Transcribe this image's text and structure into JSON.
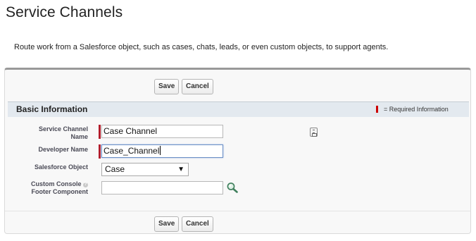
{
  "page": {
    "title": "Service Channels",
    "description": "Route work from a Salesforce object, such as cases, chats, leads, or even custom objects, to support agents."
  },
  "toolbar": {
    "save_label": "Save",
    "cancel_label": "Cancel"
  },
  "section": {
    "title": "Basic Information",
    "required_legend": "= Required Information"
  },
  "fields": {
    "channel_name": {
      "label_line1": "Service Channel",
      "label_line2": "Name",
      "value": "Case Channel",
      "icon": "context-menu-icon"
    },
    "developer_name": {
      "label": "Developer Name",
      "value": "Case_Channel"
    },
    "salesforce_object": {
      "label": "Salesforce Object",
      "value": "Case",
      "arrow": "▼"
    },
    "footer_component": {
      "label_line1": "Custom Console",
      "label_line2": "Footer Component",
      "help_icon": "?",
      "value": "",
      "icon": "lookup-magnifier-icon"
    }
  },
  "colors": {
    "required_marker": "#b31c2b",
    "section_header_bg": "#e3e9ef"
  }
}
